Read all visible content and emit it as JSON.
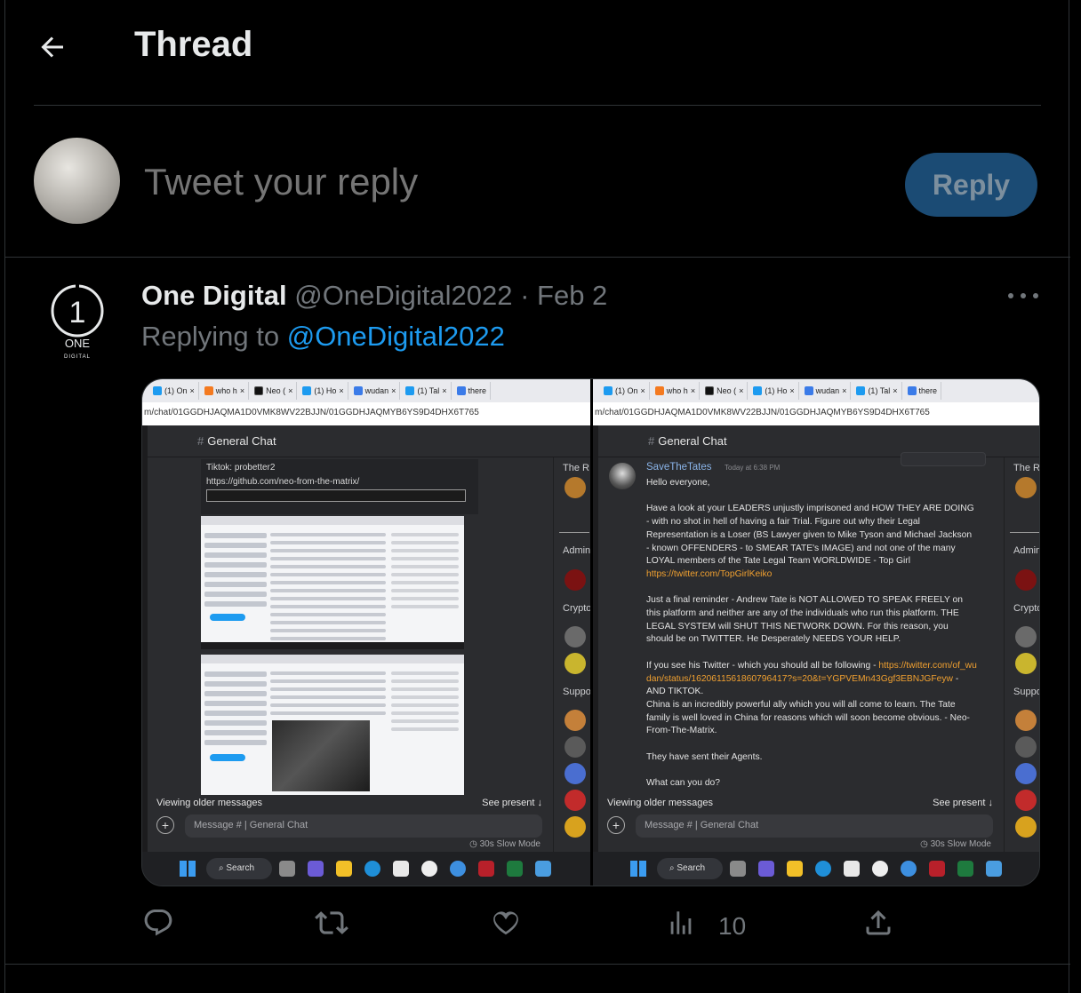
{
  "header": {
    "title": "Thread",
    "back_icon": "arrow-left-icon"
  },
  "composer": {
    "placeholder": "Tweet your reply",
    "reply_label": "Reply"
  },
  "tweet": {
    "author_name": "One Digital",
    "author_handle": "@OneDigital2022",
    "separator": "·",
    "date": "Feb 2",
    "replying_prefix": "Replying to",
    "replying_handle": "@OneDigital2022",
    "logo_text": "ONE",
    "logo_subtext": "DIGITAL",
    "logo_numeral": "1",
    "views": "10",
    "actions": [
      "reply-icon",
      "retweet-icon",
      "like-icon",
      "views-icon",
      "share-icon"
    ]
  },
  "media": {
    "tabs": [
      {
        "label": "(1) On",
        "color": "#1d9bf0"
      },
      {
        "label": "who h",
        "color": "#f47a20"
      },
      {
        "label": "Neo (",
        "color": "#111111"
      },
      {
        "label": "(1) Ho",
        "color": "#1d9bf0"
      },
      {
        "label": "wudan",
        "color": "#3b7be8"
      },
      {
        "label": "(1) Tal",
        "color": "#1d9bf0"
      },
      {
        "label": "there",
        "color": "#3b7be8"
      }
    ],
    "url": "m/chat/01GGDHJAQMA1D0VMK8WV22BJJN/01GGDHJAQMYB6YS9D4DHX6T765",
    "channel": "General Chat",
    "left": {
      "embed_line1": "Tiktok: probetter2",
      "embed_line2": "https://github.com/neo-from-the-matrix/"
    },
    "members": {
      "top": "The R",
      "admin": "Admin",
      "crypto": "Crypto",
      "support": "Suppo"
    },
    "older_messages": "Viewing older messages",
    "see_present": "See present",
    "message_placeholder": "Message #",
    "message_channel": "| General Chat",
    "slow_mode": "30s Slow Mode",
    "taskbar_search": "Search",
    "right": {
      "author": "SaveTheTates",
      "time": "Today at 6:38 PM",
      "greeting": "Hello everyone,",
      "p1": "Have a look at your LEADERS unjustly imprisoned and HOW THEY ARE DOING - with no shot in hell of having a fair Trial. Figure out why their Legal Representation is a Loser (BS Lawyer given to Mike Tyson and Michael Jackson - known OFFENDERS - to SMEAR TATE's IMAGE) and not one of the many LOYAL members of the Tate Legal Team WORLDWIDE - Top Girl",
      "p1_link": "https://twitter.com/TopGirlKeiko",
      "p2": "Just a final reminder - Andrew Tate is NOT ALLOWED TO SPEAK FREELY on this platform and neither are any of the individuals who run this platform. THE LEGAL SYSTEM will SHUT THIS NETWORK DOWN. For this reason, you should be on TWITTER. He Desperately NEEDS YOUR HELP.",
      "p3_a": "If you see his Twitter - which you should all be following -",
      "p3_link": "https://twitter.com/of_wudan/status/1620611561860796417?s=20&t=YGPVEMn43Ggf3EBNJGFeyw",
      "p3_b": "- AND TIKTOK.",
      "p3_c": "China is an incredibly powerful ally which you will all come to learn. The Tate family is well loved in China for reasons which will soon become obvious. - Neo-From-The-Matrix.",
      "p4": "They have sent their Agents.",
      "p5": "What can you do?"
    }
  },
  "colors": {
    "accent": "#1d9bf0",
    "reply_button": "#1b4b74",
    "muted": "#71767b",
    "link_orange": "#f0a030"
  }
}
